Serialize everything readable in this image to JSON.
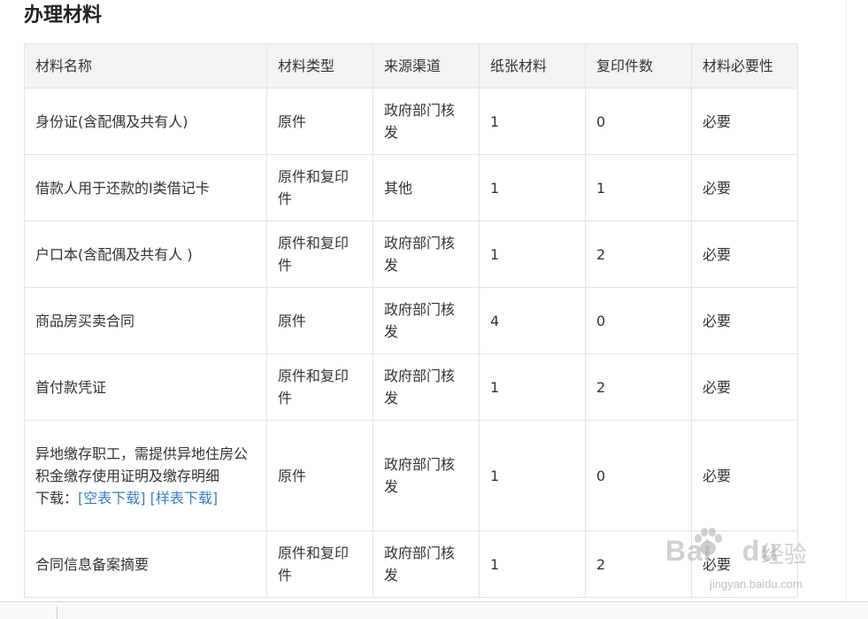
{
  "section": {
    "title": "办理材料"
  },
  "table": {
    "headers": [
      "材料名称",
      "材料类型",
      "来源渠道",
      "纸张材料",
      "复印件数",
      "材料必要性"
    ],
    "rows": [
      {
        "name": "身份证(含配偶及共有人)",
        "type": "原件",
        "source": "政府部门核发",
        "paper": "1",
        "copies": "0",
        "necessity": "必要"
      },
      {
        "name": "借款人用于还款的I类借记卡",
        "type": "原件和复印件",
        "source": "其他",
        "paper": "1",
        "copies": "1",
        "necessity": "必要"
      },
      {
        "name": "户口本(含配偶及共有人 )",
        "type": "原件和复印件",
        "source": "政府部门核发",
        "paper": "1",
        "copies": "2",
        "necessity": "必要"
      },
      {
        "name": "商品房买卖合同",
        "type": "原件",
        "source": "政府部门核发",
        "paper": "4",
        "copies": "0",
        "necessity": "必要"
      },
      {
        "name": "首付款凭证",
        "type": "原件和复印件",
        "source": "政府部门核发",
        "paper": "1",
        "copies": "2",
        "necessity": "必要"
      },
      {
        "name": "异地缴存职工，需提供异地住房公积金缴存使用证明及缴存明细",
        "download_label": "下载：",
        "download_blank": "[空表下载]",
        "download_sample": "[样表下载]",
        "type": "原件",
        "source": "政府部门核发",
        "paper": "1",
        "copies": "0",
        "necessity": "必要"
      },
      {
        "name": "合同信息备案摘要",
        "type": "原件和复印件",
        "source": "政府部门核发",
        "paper": "1",
        "copies": "2",
        "necessity": "必要"
      }
    ]
  },
  "watermark": {
    "brand": "Bai",
    "brand_tail": "du",
    "jingyan": "经验",
    "url": "jingyan.baidu.com"
  }
}
